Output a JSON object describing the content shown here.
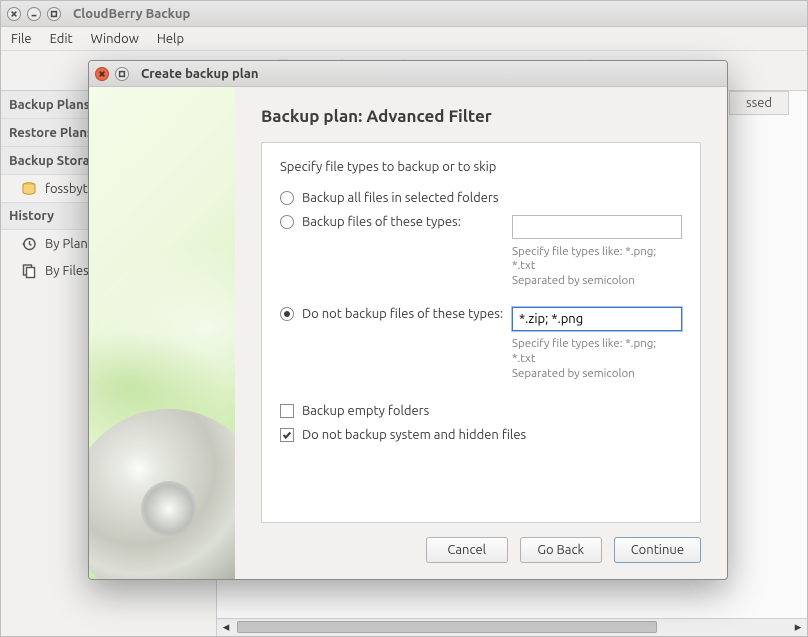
{
  "main": {
    "title": "CloudBerry Backup",
    "menu": [
      "File",
      "Edit",
      "Window",
      "Help"
    ]
  },
  "sidebar": {
    "tabs": [
      "Backup Plans",
      "Restore Plans",
      "Backup Storage"
    ],
    "storage_item": "fossbyt",
    "history_header": "History",
    "history_items": [
      "By Plan",
      "By Files"
    ]
  },
  "colheader": "ssed",
  "dialog": {
    "title": "Create backup plan",
    "heading": "Backup plan: Advanced Filter",
    "instr": "Specify file types to backup or to skip",
    "opt1": "Backup all files in selected folders",
    "opt2": "Backup files of these types:",
    "opt3": "Do not backup files of these types:",
    "types_value": "*.zip; *.png",
    "hint1": "Specify file types like: *.png; *.txt",
    "hint2": "Separated by semicolon",
    "chk1": "Backup empty folders",
    "chk2": "Do not backup system and hidden files",
    "buttons": {
      "cancel": "Cancel",
      "back": "Go Back",
      "continue": "Continue"
    }
  }
}
